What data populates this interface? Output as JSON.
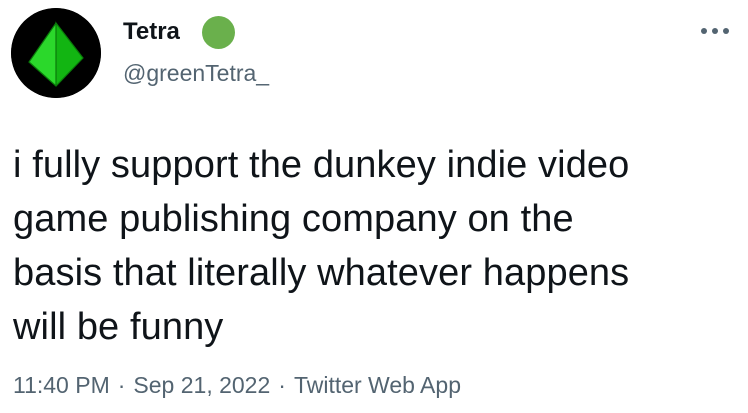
{
  "tweet": {
    "author": {
      "display_name": "Tetra",
      "handle": "@greenTetra_",
      "avatar_icon": "green-tetrahedron-icon",
      "status_dot_color": "#6ab04c"
    },
    "more_icon": "more-dots-icon",
    "text": "i fully support the dunkey indie video\ngame publishing company on the\nbasis that literally whatever happens\nwill be funny",
    "meta": {
      "time": "11:40 PM",
      "date": "Sep 21, 2022",
      "separator": "·",
      "source": "Twitter Web App"
    }
  }
}
